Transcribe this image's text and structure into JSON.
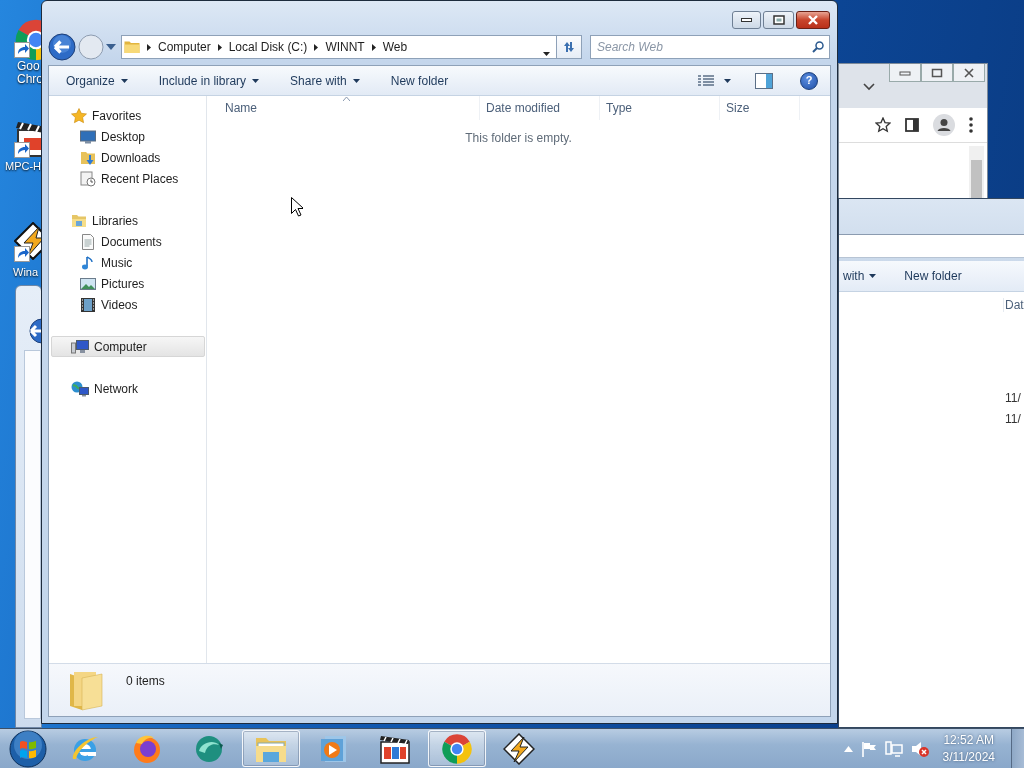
{
  "desktop_icons": [
    {
      "lines": [
        "Goo",
        "Chro"
      ]
    },
    {
      "lines": [
        "MPC-H"
      ]
    },
    {
      "lines": [
        "Wina"
      ]
    }
  ],
  "explorer": {
    "address": {
      "path": [
        "Computer",
        "Local Disk (C:)",
        "WINNT",
        "Web"
      ]
    },
    "search": {
      "placeholder": "Search Web"
    },
    "toolbar": [
      {
        "label": "Organize",
        "dropdown": true
      },
      {
        "label": "Include in library",
        "dropdown": true
      },
      {
        "label": "Share with",
        "dropdown": true
      },
      {
        "label": "New folder",
        "dropdown": false
      }
    ],
    "navigation": [
      {
        "label": "Favorites",
        "selected": false,
        "children": [
          {
            "label": "Desktop",
            "selected": false
          },
          {
            "label": "Downloads",
            "selected": false
          },
          {
            "label": "Recent Places",
            "selected": false
          }
        ]
      },
      {
        "label": "Libraries",
        "selected": false,
        "children": [
          {
            "label": "Documents",
            "selected": false
          },
          {
            "label": "Music",
            "selected": false
          },
          {
            "label": "Pictures",
            "selected": false
          },
          {
            "label": "Videos",
            "selected": false
          }
        ]
      },
      {
        "label": "Computer",
        "selected": true
      },
      {
        "label": "Network",
        "selected": false
      }
    ],
    "columns": [
      {
        "label": "Name",
        "sorted": true
      },
      {
        "label": "Date modified",
        "sorted": false
      },
      {
        "label": "Type",
        "sorted": false
      },
      {
        "label": "Size",
        "sorted": false
      }
    ],
    "help_button": {
      "symbol": "?"
    },
    "empty_message": "This folder is empty.",
    "details": {
      "item_count": "0 items"
    }
  },
  "background_explorer": {
    "toolbar": [
      {
        "label": "with",
        "dropdown": true
      },
      {
        "label": "New folder",
        "dropdown": false
      }
    ],
    "columns": [
      {
        "label": "Dat"
      }
    ],
    "rows": [
      {
        "date": "11/"
      },
      {
        "date": "11/"
      }
    ]
  },
  "taskbar": {
    "apps": [
      {
        "running": false
      },
      {
        "running": false
      },
      {
        "running": false
      },
      {
        "running": true
      },
      {
        "running": false
      },
      {
        "running": false
      },
      {
        "running": true
      },
      {
        "running": false
      }
    ],
    "clock": {
      "time": "12:52 AM",
      "date": "3/11/2024"
    }
  }
}
